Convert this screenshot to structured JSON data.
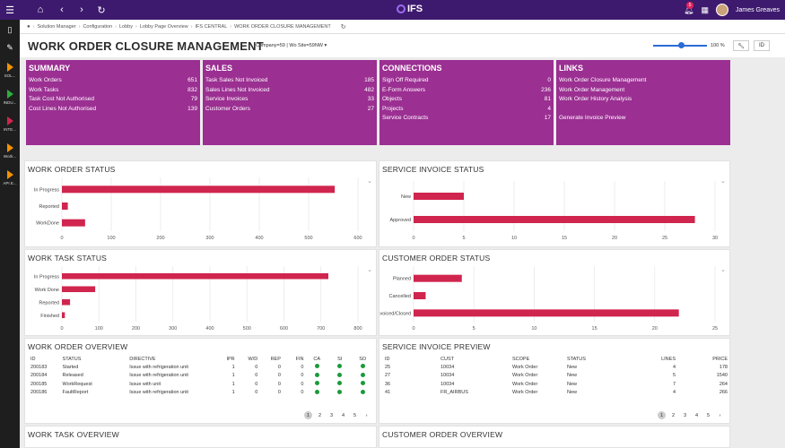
{
  "topbar": {
    "logo": "IFS",
    "notification_count": "5",
    "user_name": "James Greaves"
  },
  "rail": {
    "items": [
      {
        "label": "SOL..."
      },
      {
        "label": "INDU..."
      },
      {
        "label": "INTE..."
      },
      {
        "label": "Work..."
      },
      {
        "label": "API E..."
      }
    ]
  },
  "breadcrumb": [
    "Solution Manager",
    "Configuration",
    "Lobby",
    "Lobby Page Overview",
    "IFS CENTRAL",
    "WORK ORDER CLOSURE MANAGEMENT"
  ],
  "header": {
    "title": "WORK ORDER CLOSURE MANAGEMENT",
    "context": "Company=59 | Wo Site=59NW",
    "zoom": "100 %"
  },
  "tiles": {
    "summary": {
      "title": "SUMMARY",
      "rows": [
        {
          "label": "Work Orders",
          "value": "651"
        },
        {
          "label": "Work Tasks",
          "value": "832"
        },
        {
          "label": "Task Cost Not Authorised",
          "value": "79"
        },
        {
          "label": "Cost Lines Not Authorised",
          "value": "139"
        }
      ]
    },
    "sales": {
      "title": "SALES",
      "rows": [
        {
          "label": "Task Sales Not Invoiced",
          "value": "185"
        },
        {
          "label": "Sales Lines Not Invoiced",
          "value": "482"
        },
        {
          "label": "Service Invoices",
          "value": "33"
        },
        {
          "label": "Customer Orders",
          "value": "27"
        }
      ]
    },
    "connections": {
      "title": "CONNECTIONS",
      "rows": [
        {
          "label": "Sign Off Required",
          "value": "0"
        },
        {
          "label": "E-Form Answers",
          "value": "236"
        },
        {
          "label": "Objects",
          "value": "81"
        },
        {
          "label": "Projects",
          "value": "4"
        },
        {
          "label": "Service Contracts",
          "value": "17"
        }
      ]
    },
    "links": {
      "title": "LINKS",
      "items": [
        "Work Order Closure Management",
        "Work Order Management",
        "Work Order History Analysis",
        "",
        "Generate Invoice Preview"
      ]
    }
  },
  "colors": {
    "bar": "#d0254e",
    "tile": "#9b2f92",
    "topbar": "#3d1a6e"
  },
  "chart_data": [
    {
      "type": "bar",
      "orientation": "horizontal",
      "title": "WORK ORDER STATUS",
      "categories": [
        "In Progress",
        "Reported",
        "WorkDone"
      ],
      "values": [
        553,
        12,
        47
      ],
      "xlim": [
        0,
        600
      ],
      "ticks": [
        0,
        100,
        200,
        300,
        400,
        500,
        600
      ]
    },
    {
      "type": "bar",
      "orientation": "horizontal",
      "title": "SERVICE INVOICE STATUS",
      "categories": [
        "New",
        "Approved"
      ],
      "values": [
        5,
        28
      ],
      "xlim": [
        0,
        30
      ],
      "ticks": [
        0,
        5,
        10,
        15,
        20,
        25,
        30
      ]
    },
    {
      "type": "bar",
      "orientation": "horizontal",
      "title": "WORK TASK STATUS",
      "categories": [
        "In Progress",
        "Work Done",
        "Reported",
        "Finished"
      ],
      "values": [
        720,
        90,
        22,
        8
      ],
      "xlim": [
        0,
        800
      ],
      "ticks": [
        0,
        100,
        200,
        300,
        400,
        500,
        600,
        700,
        800
      ]
    },
    {
      "type": "bar",
      "orientation": "horizontal",
      "title": "CUSTOMER ORDER STATUS",
      "categories": [
        "Planned",
        "Cancelled",
        "Invoiced/Closed"
      ],
      "values": [
        4,
        1,
        22
      ],
      "xlim": [
        0,
        25
      ],
      "ticks": [
        0,
        5,
        10,
        15,
        20,
        25
      ]
    }
  ],
  "work_order_overview": {
    "title": "WORK ORDER OVERVIEW",
    "columns": [
      "ID",
      "STATUS",
      "DIRECTIVE",
      "IPR",
      "W/D",
      "REP",
      "FIN",
      "CA",
      "SI",
      "SO"
    ],
    "rows": [
      [
        "200183",
        "Started",
        "Issue with refrigeration unit",
        "1",
        "0",
        "0",
        "0"
      ],
      [
        "200184",
        "Released",
        "Issue with refrigeration unit",
        "1",
        "0",
        "0",
        "0"
      ],
      [
        "200185",
        "WorkRequest",
        "Issue with unit",
        "1",
        "0",
        "0",
        "0"
      ],
      [
        "200186",
        "FaultReport",
        "Issue with refrigeration unit",
        "1",
        "0",
        "0",
        "0"
      ]
    ],
    "pages": [
      "1",
      "2",
      "3",
      "4",
      "5",
      "›"
    ]
  },
  "service_invoice_preview": {
    "title": "SERVICE INVOICE PREVIEW",
    "columns": [
      "ID",
      "CUST",
      "SCOPE",
      "STATUS",
      "LINES",
      "PRICE"
    ],
    "rows": [
      [
        "25",
        "10034",
        "Work Order",
        "New",
        "4",
        "178"
      ],
      [
        "27",
        "10034",
        "Work Order",
        "New",
        "5",
        "1540"
      ],
      [
        "36",
        "10034",
        "Work Order",
        "New",
        "7",
        "264"
      ],
      [
        "41",
        "FR_AIRBUS",
        "Work Order",
        "New",
        "4",
        "266"
      ]
    ],
    "pages": [
      "1",
      "2",
      "3",
      "4",
      "5",
      "›"
    ]
  },
  "bottom": {
    "work_task_overview": "WORK TASK OVERVIEW",
    "customer_order_overview": "CUSTOMER ORDER OVERVIEW"
  }
}
